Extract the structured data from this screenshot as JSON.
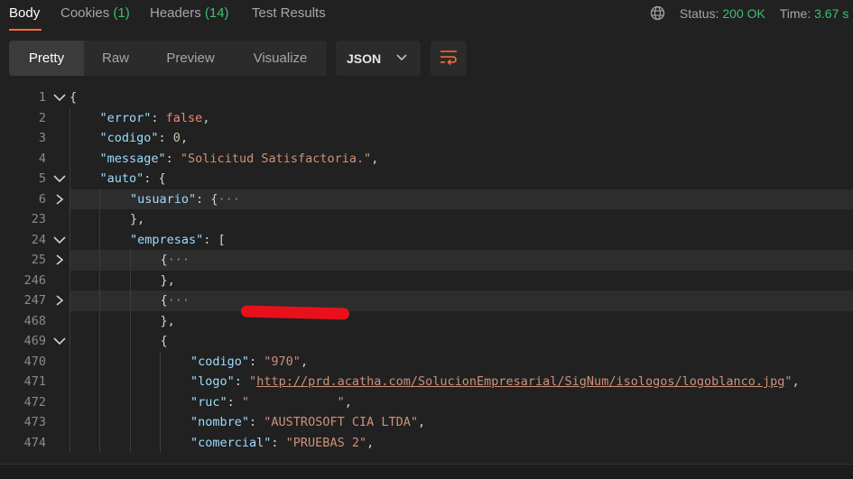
{
  "tabs": [
    {
      "label": "Body",
      "count": ""
    },
    {
      "label": "Cookies",
      "count": "(1)"
    },
    {
      "label": "Headers",
      "count": "(14)"
    },
    {
      "label": "Test Results",
      "count": ""
    }
  ],
  "status": {
    "label": "Status:",
    "value": "200 OK",
    "time_label": "Time:",
    "time_value": "3.67 s"
  },
  "view_modes": [
    "Pretty",
    "Raw",
    "Preview",
    "Visualize"
  ],
  "format": "JSON",
  "lines": [
    {
      "n": "1",
      "fold": "open",
      "code": [
        [
          "p",
          "{"
        ]
      ]
    },
    {
      "n": "2",
      "code": [
        [
          "k",
          "\"error\""
        ],
        [
          "p",
          ": "
        ],
        [
          "b",
          "false"
        ],
        [
          "p",
          ","
        ]
      ]
    },
    {
      "n": "3",
      "code": [
        [
          "k",
          "\"codigo\""
        ],
        [
          "p",
          ": "
        ],
        [
          "n",
          "0"
        ],
        [
          "p",
          ","
        ]
      ]
    },
    {
      "n": "4",
      "code": [
        [
          "k",
          "\"message\""
        ],
        [
          "p",
          ": "
        ],
        [
          "s",
          "\"Solicitud Satisfactoria.\""
        ],
        [
          "p",
          ","
        ]
      ]
    },
    {
      "n": "5",
      "fold": "open",
      "code": [
        [
          "k",
          "\"auto\""
        ],
        [
          "p",
          ": {"
        ]
      ]
    },
    {
      "n": "6",
      "fold": "closed",
      "code": [
        [
          "k",
          "\"usuario\""
        ],
        [
          "p",
          ": {"
        ],
        [
          "ell",
          "···"
        ]
      ]
    },
    {
      "n": "23",
      "code": [
        [
          "p",
          "},"
        ]
      ]
    },
    {
      "n": "24",
      "fold": "open",
      "code": [
        [
          "k",
          "\"empresas\""
        ],
        [
          "p",
          ": ["
        ]
      ]
    },
    {
      "n": "25",
      "fold": "closed",
      "code": [
        [
          "p",
          "{"
        ],
        [
          "ell",
          "···"
        ]
      ]
    },
    {
      "n": "246",
      "code": [
        [
          "p",
          "},"
        ]
      ]
    },
    {
      "n": "247",
      "fold": "closed",
      "code": [
        [
          "p",
          "{"
        ],
        [
          "ell",
          "···"
        ]
      ]
    },
    {
      "n": "468",
      "code": [
        [
          "p",
          "},"
        ]
      ]
    },
    {
      "n": "469",
      "fold": "open",
      "code": [
        [
          "p",
          "{"
        ]
      ]
    },
    {
      "n": "470",
      "code": [
        [
          "k",
          "\"codigo\""
        ],
        [
          "p",
          ": "
        ],
        [
          "s",
          "\"970\""
        ],
        [
          "p",
          ","
        ]
      ]
    },
    {
      "n": "471",
      "code": [
        [
          "k",
          "\"logo\""
        ],
        [
          "p",
          ": "
        ],
        [
          "s",
          "\""
        ],
        [
          "u",
          "http://prd.acatha.com/SolucionEmpresarial/SigNum/isologos/logoblanco.jpg"
        ],
        [
          "s",
          "\""
        ],
        [
          "p",
          ","
        ]
      ]
    },
    {
      "n": "472",
      "code": [
        [
          "k",
          "\"ruc\""
        ],
        [
          "p",
          ": "
        ],
        [
          "s",
          "\"            \""
        ],
        [
          "p",
          ","
        ]
      ]
    },
    {
      "n": "473",
      "code": [
        [
          "k",
          "\"nombre\""
        ],
        [
          "p",
          ": "
        ],
        [
          "s",
          "\"AUSTROSOFT CIA LTDA\""
        ],
        [
          "p",
          ","
        ]
      ]
    },
    {
      "n": "474",
      "code": [
        [
          "k",
          "\"comercial\""
        ],
        [
          "p",
          ": "
        ],
        [
          "s",
          "\"PRUEBAS 2\""
        ],
        [
          "p",
          ","
        ]
      ]
    }
  ]
}
